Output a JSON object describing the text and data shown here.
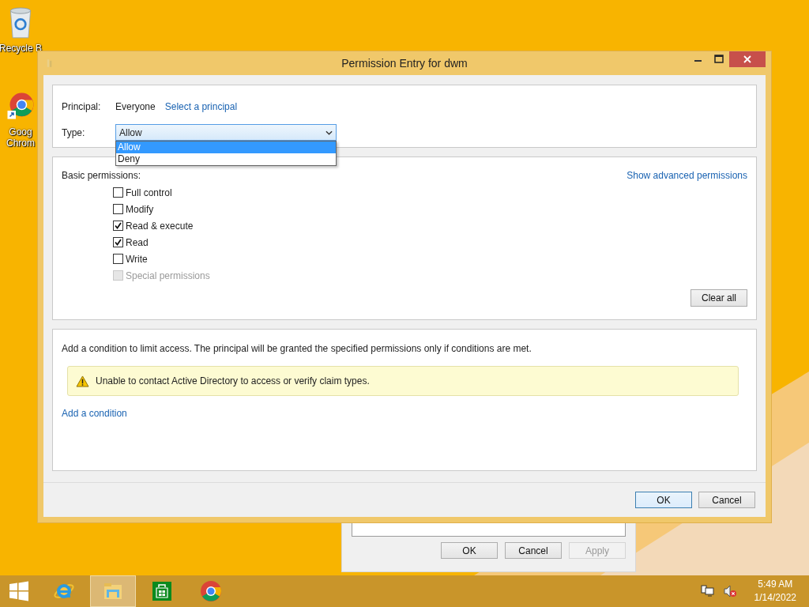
{
  "desktop": {
    "icons": [
      {
        "kind": "recycle-bin",
        "lines": [
          "Recycle B"
        ]
      },
      {
        "kind": "chrome",
        "lines": [
          "Goog",
          "Chrom"
        ]
      }
    ]
  },
  "background_window": {
    "buttons": [
      {
        "label": "OK",
        "disabled": false
      },
      {
        "label": "Cancel",
        "disabled": false
      },
      {
        "label": "Apply",
        "disabled": true
      }
    ]
  },
  "dialog": {
    "title": "Permission Entry for dwm",
    "principal": {
      "label": "Principal:",
      "value": "Everyone",
      "link": "Select a principal"
    },
    "type": {
      "label": "Type:",
      "value": "Allow",
      "expanded": true,
      "options": [
        {
          "label": "Allow",
          "selected": true
        },
        {
          "label": "Deny",
          "selected": false
        }
      ]
    },
    "permissions": {
      "label": "Basic permissions:",
      "link": "Show advanced permissions",
      "items": [
        {
          "label": "Full control",
          "checked": false,
          "disabled": false
        },
        {
          "label": "Modify",
          "checked": false,
          "disabled": false
        },
        {
          "label": "Read & execute",
          "checked": true,
          "disabled": false
        },
        {
          "label": "Read",
          "checked": true,
          "disabled": false
        },
        {
          "label": "Write",
          "checked": false,
          "disabled": false
        },
        {
          "label": "Special permissions",
          "checked": false,
          "disabled": true
        }
      ],
      "clear_button": "Clear all"
    },
    "conditions": {
      "text": "Add a condition to limit access. The principal will be granted the specified permissions only if conditions are met.",
      "warning": "Unable to contact Active Directory to access or verify claim types.",
      "link": "Add a condition"
    },
    "buttons": [
      {
        "label": "OK",
        "default": true
      },
      {
        "label": "Cancel",
        "default": false
      }
    ]
  },
  "taskbar": {
    "apps": [
      {
        "kind": "start",
        "selected": false
      },
      {
        "kind": "ie",
        "selected": false
      },
      {
        "kind": "explorer",
        "selected": true
      },
      {
        "kind": "store",
        "selected": false
      },
      {
        "kind": "chrome",
        "selected": false
      }
    ],
    "clock": {
      "time": "5:49 AM",
      "date": "1/14/2022"
    }
  }
}
